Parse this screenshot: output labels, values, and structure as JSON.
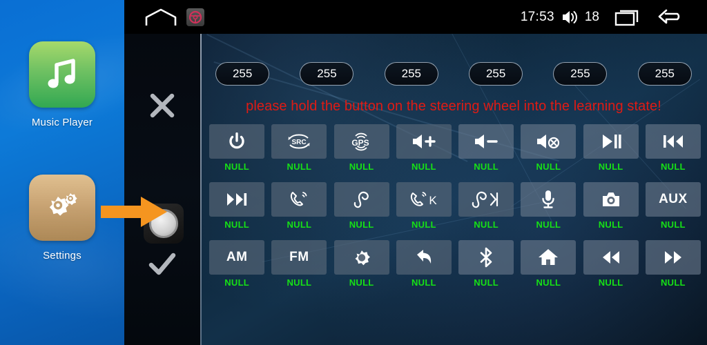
{
  "launcher": {
    "apps": [
      {
        "label": "Music Player",
        "icon": "music-note-icon",
        "color": "#4cb85c"
      },
      {
        "label": "Settings",
        "icon": "gears-icon",
        "color": "#c9a474"
      }
    ],
    "arrow": {
      "icon": "orange-arrow-right-icon",
      "color": "#f59520"
    }
  },
  "statusbar": {
    "home_icon": "home-outline-icon",
    "app_icon": "steering-wheel-icon",
    "clock": "17:53",
    "volume_icon": "volume-icon",
    "volume_level": "18",
    "recents_icon": "recents-icon",
    "back_icon": "back-arrow-icon"
  },
  "side_controls": {
    "cancel_icon": "close-x-icon",
    "confirm_icon": "checkmark-icon",
    "knob_icon": "rotary-knob-icon"
  },
  "pills": [
    {
      "value": "255"
    },
    {
      "value": "255"
    },
    {
      "value": "255"
    },
    {
      "value": "255"
    },
    {
      "value": "255"
    },
    {
      "value": "255"
    }
  ],
  "warning": {
    "text": "please hold the button on the steering wheel into the learning state!",
    "color": "#e01b14"
  },
  "grid": {
    "label_color": "#16e016",
    "rows": [
      [
        {
          "icon": "power-icon",
          "text": "",
          "label": "NULL"
        },
        {
          "icon": "src-icon",
          "text": "SRC",
          "label": "NULL"
        },
        {
          "icon": "gps-icon",
          "text": "GPS",
          "label": "NULL"
        },
        {
          "icon": "volume-up-icon",
          "text": "",
          "label": "NULL"
        },
        {
          "icon": "volume-down-icon",
          "text": "",
          "label": "NULL"
        },
        {
          "icon": "volume-mute-icon",
          "text": "",
          "label": "NULL"
        },
        {
          "icon": "play-pause-icon",
          "text": "",
          "label": "NULL"
        },
        {
          "icon": "previous-track-icon",
          "text": "",
          "label": "NULL"
        }
      ],
      [
        {
          "icon": "next-track-icon",
          "text": "",
          "label": "NULL"
        },
        {
          "icon": "call-answer-icon",
          "text": "",
          "label": "NULL"
        },
        {
          "icon": "call-end-icon",
          "text": "",
          "label": "NULL"
        },
        {
          "icon": "call-answer-k-icon",
          "text": "K",
          "label": "NULL"
        },
        {
          "icon": "call-end-next-icon",
          "text": "",
          "label": "NULL"
        },
        {
          "icon": "microphone-icon",
          "text": "",
          "label": "NULL"
        },
        {
          "icon": "camera-icon",
          "text": "",
          "label": "NULL"
        },
        {
          "icon": "aux-icon",
          "text": "AUX",
          "label": "NULL"
        }
      ],
      [
        {
          "icon": "am-icon",
          "text": "AM",
          "label": "NULL"
        },
        {
          "icon": "fm-icon",
          "text": "FM",
          "label": "NULL"
        },
        {
          "icon": "brightness-icon",
          "text": "",
          "label": "NULL"
        },
        {
          "icon": "back-arrow-icon",
          "text": "",
          "label": "NULL"
        },
        {
          "icon": "bluetooth-icon",
          "text": "",
          "label": "NULL"
        },
        {
          "icon": "home-icon",
          "text": "",
          "label": "NULL"
        },
        {
          "icon": "rewind-icon",
          "text": "",
          "label": "NULL"
        },
        {
          "icon": "fast-forward-icon",
          "text": "",
          "label": "NULL"
        }
      ]
    ]
  }
}
